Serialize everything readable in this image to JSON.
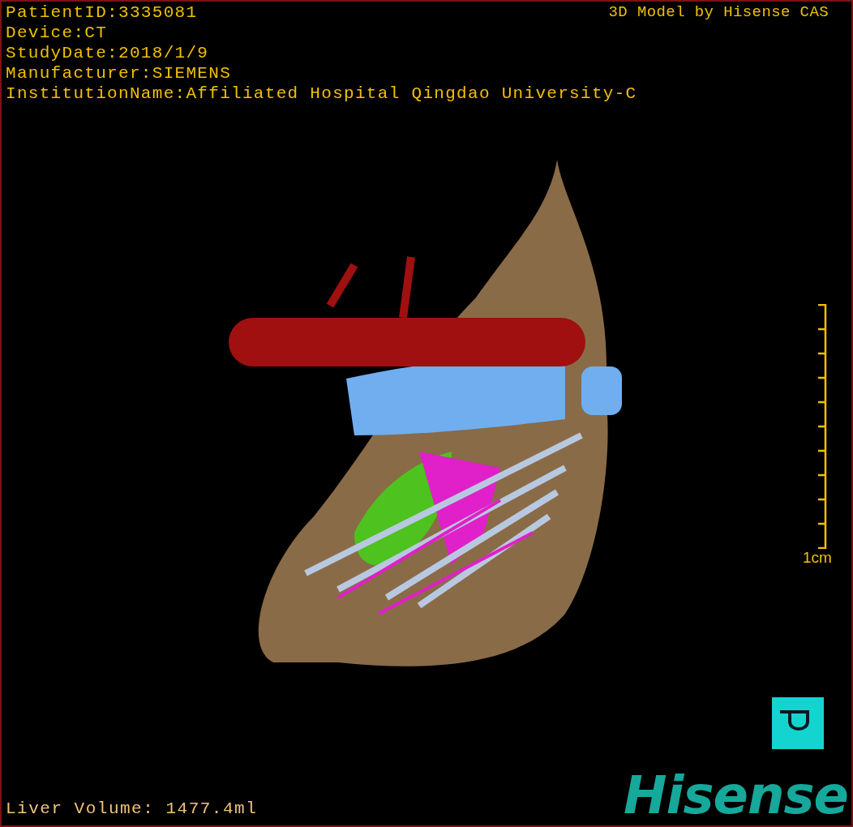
{
  "info_lines": [
    "PatientID:3335081",
    "Device:CT",
    "StudyDate:2018/1/9",
    "Manufacturer:SIEMENS",
    "InstitutionName:Affiliated Hospital Qingdao University-C"
  ],
  "title": "3D Model by Hisense CAS",
  "scale": {
    "label": "1cm"
  },
  "volume": "Liver Volume: 1477.4ml",
  "brand": "Hisense"
}
